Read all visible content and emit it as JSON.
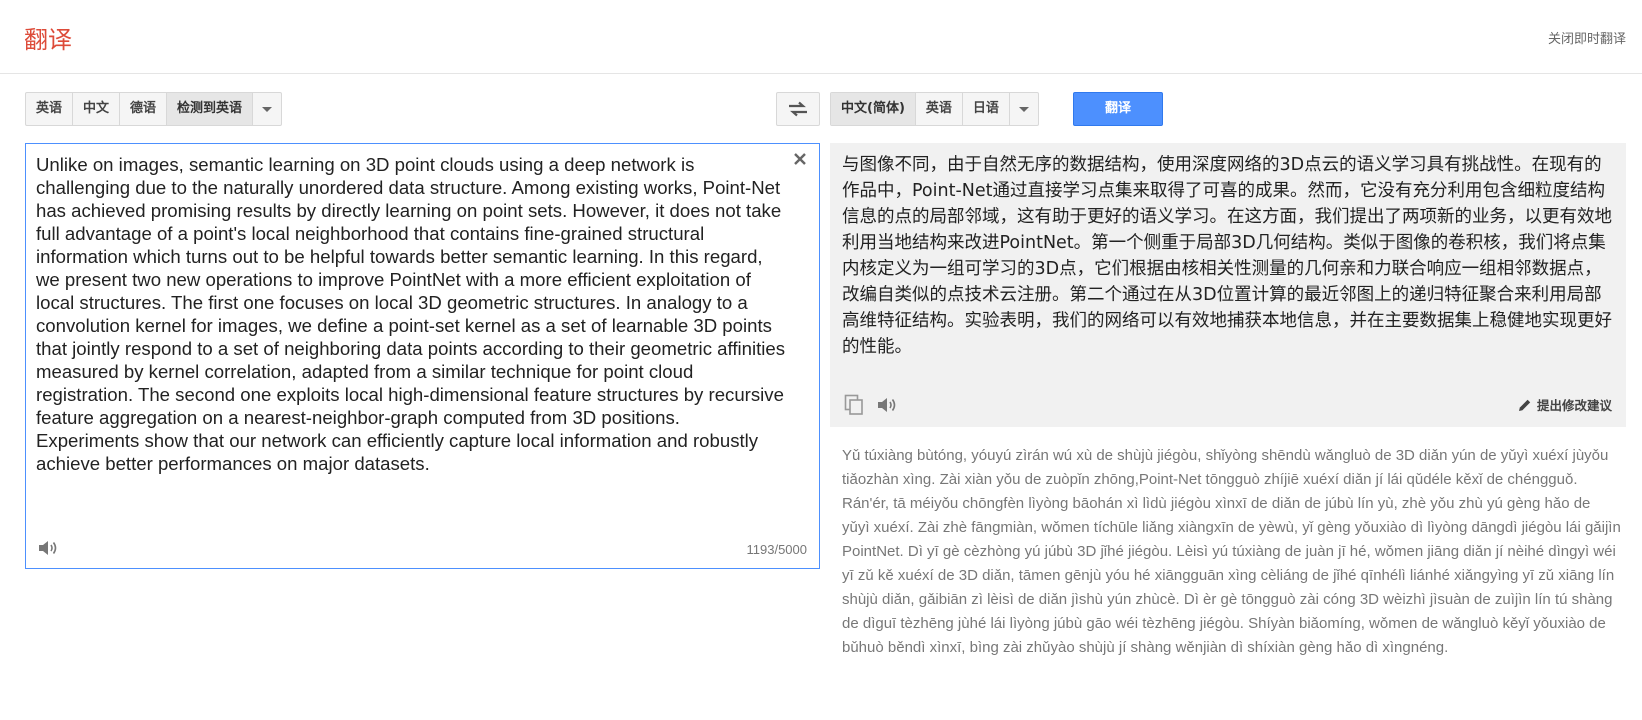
{
  "header": {
    "logo": "翻译",
    "close_instant": "关闭即时翻译"
  },
  "source_langs": {
    "items": [
      "英语",
      "中文",
      "德语",
      "检测到英语"
    ],
    "active_index": 3
  },
  "target_langs": {
    "items": [
      "中文(简体)",
      "英语",
      "日语"
    ],
    "active_index": 0
  },
  "translate_button": "翻译",
  "source": {
    "text": "Unlike on images, semantic learning on 3D point clouds using a deep network is challenging due to the naturally unordered data structure. Among existing works, Point-Net has achieved promising results by directly learning on point sets. However, it does not take full advantage of a point's local neighborhood that contains fine-grained structural information which turns out to be helpful towards better semantic learning. In this regard, we present two new operations to improve PointNet with a more efficient exploitation of local structures. The first one focuses on local 3D geometric structures. In analogy to a convolution kernel for images, we define a point-set kernel as a set of learnable 3D points that jointly respond to a set of neighboring data points according to their geometric affinities measured by kernel correlation, adapted from a similar technique for point cloud registration. The second one exploits local high-dimensional feature structures by recursive feature aggregation on a nearest-neighbor-graph computed from 3D positions. Experiments show that our network can efficiently capture local information and robustly achieve better performances on major datasets.",
    "char_count": "1193/5000"
  },
  "result": {
    "text": "与图像不同，由于自然无序的数据结构，使用深度网络的3D点云的语义学习具有挑战性。在现有的作品中，Point-Net通过直接学习点集来取得了可喜的成果。然而，它没有充分利用包含细粒度结构信息的点的局部邻域，这有助于更好的语义学习。在这方面，我们提出了两项新的业务，以更有效地利用当地结构来改进PointNet。第一个侧重于局部3D几何结构。类似于图像的卷积核，我们将点集内核定义为一组可学习的3D点，它们根据由核相关性测量的几何亲和力联合响应一组相邻数据点，改编自类似的点技术云注册。第二个通过在从3D位置计算的最近邻图上的递归特征聚合来利用局部高维特征结构。实验表明，我们的网络可以有效地捕获本地信息，并在主要数据集上稳健地实现更好的性能。",
    "suggest_label": "提出修改建议"
  },
  "pinyin": "Yǔ túxiàng bùtóng, yóuyú zìrán wú xù de shùjù jiégòu, shǐyòng shēndù wǎngluò de 3D diǎn yún de yǔyì xuéxí jùyǒu tiǎozhàn xìng. Zài xiàn yǒu de zuòpǐn zhōng,Point-Net tōngguò zhíjiē xuéxí diǎn jí lái qǔdéle kěxǐ de chéngguǒ. Rán'ér, tā méiyǒu chōngfèn lìyòng bāohán xì lìdù jiégòu xìnxī de diǎn de júbù lín yù, zhè yǒu zhù yú gèng hǎo de yǔyì xuéxí. Zài zhè fāngmiàn, wǒmen tíchūle liǎng xiàngxīn de yèwù, yǐ gèng yǒuxiào dì lìyòng dāngdì jiégòu lái gǎijìn PointNet. Dì yī gè cèzhòng yú júbù 3D jǐhé jiégòu. Lèisì yú túxiàng de juàn jī hé, wǒmen jiāng diǎn jí nèihé dìngyì wéi yī zǔ kě xuéxí de 3D diǎn, tāmen gēnjù yóu hé xiāngguān xìng cèliáng de jǐhé qīnhélì liánhé xiǎngyìng yī zǔ xiāng lín shùjù diǎn, gǎibiān zì lèisì de diǎn jìshù yún zhùcè. Dì èr gè tōngguò zài cóng 3D wèizhì jìsuàn de zuìjìn lín tú shàng de dìguī tèzhēng jùhé lái lìyòng júbù gāo wéi tèzhēng jiégòu. Shíyàn biǎomíng, wǒmen de wǎngluò kěyǐ yǒuxiào de bǔhuò běndì xìnxī, bìng zài zhǔyào shùjù jí shàng wěnjiàn dì shíxiàn gèng hǎo dì xìngnéng.",
  "colors": {
    "logo": "#dd4b39",
    "translate_button": "#4d90fe",
    "source_border": "#4d90fe",
    "result_bg": "#f1f1f1",
    "pinyin_text": "#777777"
  },
  "icons": {
    "swap": "swap-icon",
    "clear": "close-icon",
    "speaker": "speaker-icon",
    "copy": "copy-icon",
    "suggest": "pencil-icon",
    "dropdown": "chevron-down-icon"
  }
}
